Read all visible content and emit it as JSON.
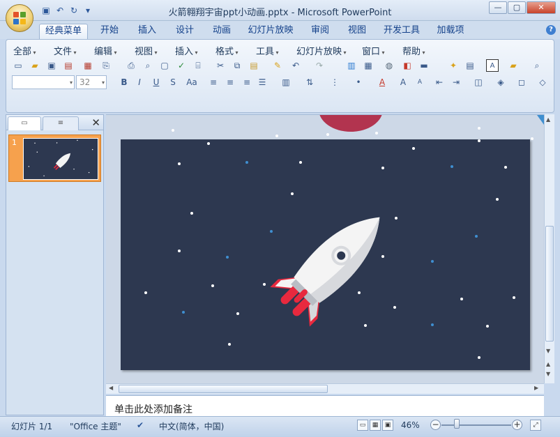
{
  "window": {
    "title": "火箭翱翔宇宙ppt小动画.pptx - Microsoft PowerPoint",
    "controls": {
      "minimize": "—",
      "maximize": "▢",
      "close": "✕"
    }
  },
  "quick_access": [
    {
      "icon": "save-icon"
    },
    {
      "icon": "undo-icon"
    },
    {
      "icon": "redo-icon"
    },
    {
      "icon": "customize-icon"
    }
  ],
  "tabs": [
    {
      "label": "经典菜单",
      "active": true
    },
    {
      "label": "开始"
    },
    {
      "label": "插入"
    },
    {
      "label": "设计"
    },
    {
      "label": "动画"
    },
    {
      "label": "幻灯片放映"
    },
    {
      "label": "审阅"
    },
    {
      "label": "视图"
    },
    {
      "label": "开发工具"
    },
    {
      "label": "加载项"
    }
  ],
  "classic_menu": [
    "全部",
    "文件",
    "编辑",
    "视图",
    "插入",
    "格式",
    "工具",
    "幻灯片放映",
    "窗口",
    "帮助"
  ],
  "format": {
    "font_name": "",
    "font_size": "32"
  },
  "left_panel": {
    "slide_number": "1"
  },
  "notes_placeholder": "单击此处添加备注",
  "status": {
    "slide": "幻灯片 1/1",
    "theme": "\"Office 主题\"",
    "language": "中文(简体，中国)",
    "zoom": "46%"
  },
  "colors": {
    "slide_bg": "#2d3850",
    "planet": "#b2344f",
    "rocket_body": "#f4f4f4",
    "rocket_accent": "#e8293e",
    "star_white": "#ffffff",
    "star_blue": "#3f8fd0"
  }
}
